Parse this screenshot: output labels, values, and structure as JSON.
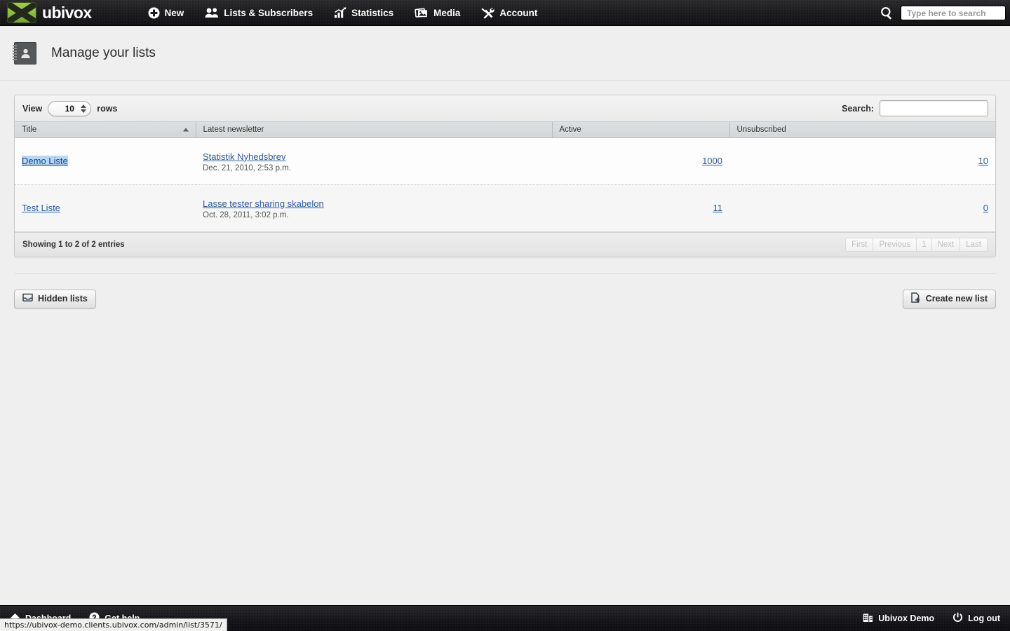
{
  "topnav": {
    "brand": "ubivox",
    "items": [
      {
        "label": "New",
        "icon": "plus-circle-icon"
      },
      {
        "label": "Lists & Subscribers",
        "icon": "users-icon"
      },
      {
        "label": "Statistics",
        "icon": "bar-chart-icon"
      },
      {
        "label": "Media",
        "icon": "image-icon"
      },
      {
        "label": "Account",
        "icon": "tools-icon"
      }
    ],
    "search": {
      "placeholder": "Type here to search",
      "value": "",
      "icon": "magnifier-icon"
    }
  },
  "page": {
    "title": "Manage your lists",
    "icon": "address-book-icon"
  },
  "table_controls": {
    "view_label": "View",
    "rows_label": "rows",
    "rows_value": "10",
    "search_label": "Search:",
    "search_value": "",
    "search_placeholder": ""
  },
  "table": {
    "columns": [
      {
        "key": "title",
        "label": "Title",
        "sorted": "asc"
      },
      {
        "key": "latest",
        "label": "Latest newsletter"
      },
      {
        "key": "active",
        "label": "Active"
      },
      {
        "key": "unsub",
        "label": "Unsubscribed"
      }
    ],
    "rows": [
      {
        "title": "Demo Liste",
        "title_selected": true,
        "newsletter": "Statistik Nyhedsbrev",
        "newsletter_date": "Dec. 21, 2010, 2:53 p.m.",
        "active": "1000",
        "unsubscribed": "10"
      },
      {
        "title": "Test Liste",
        "title_selected": false,
        "newsletter": "Lasse tester sharing skabelon",
        "newsletter_date": "Oct. 28, 2011, 3:02 p.m.",
        "active": "11",
        "unsubscribed": "0"
      }
    ],
    "footer": {
      "entries_info": "Showing 1 to 2 of 2 entries",
      "pager": [
        {
          "label": "First",
          "disabled": true
        },
        {
          "label": "Previous",
          "disabled": true
        },
        {
          "label": "1",
          "disabled": true,
          "current": true
        },
        {
          "label": "Next",
          "disabled": true
        },
        {
          "label": "Last",
          "disabled": true
        }
      ]
    }
  },
  "actions": {
    "hidden_lists": {
      "label": "Hidden lists",
      "icon": "inbox-tray-icon"
    },
    "create_new_list": {
      "label": "Create new list",
      "icon": "file-plus-icon"
    }
  },
  "footer": {
    "left": [
      {
        "label": "Dashboard",
        "icon": "home-icon"
      },
      {
        "label": "Get help",
        "icon": "question-circle-icon"
      }
    ],
    "right": [
      {
        "label": "Ubivox Demo",
        "icon": "building-icon"
      },
      {
        "label": "Log out",
        "icon": "power-icon"
      }
    ]
  },
  "status_bar": {
    "url": "https://ubivox-demo.clients.ubivox.com/admin/list/3571/"
  },
  "colors": {
    "brand_green": "#8ec043",
    "link_blue": "#2a5c9b",
    "selection_blue": "#b9d7f5",
    "nav_dark": "#1a1a1c",
    "page_bg": "#efefef"
  }
}
